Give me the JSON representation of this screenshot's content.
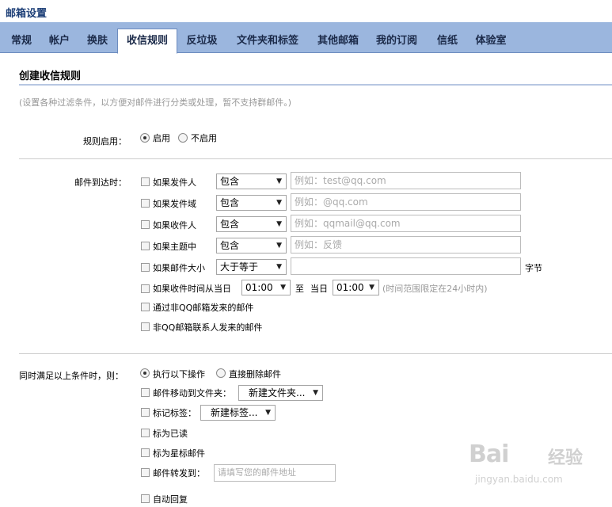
{
  "window": {
    "title": "邮箱设置"
  },
  "tabs": [
    {
      "label": "常规"
    },
    {
      "label": "帐户"
    },
    {
      "label": "换肤"
    },
    {
      "label": "收信规则"
    },
    {
      "label": "反垃圾"
    },
    {
      "label": "文件夹和标签"
    },
    {
      "label": "其他邮箱"
    },
    {
      "label": "我的订阅"
    },
    {
      "label": "信纸"
    },
    {
      "label": "体验室"
    }
  ],
  "section": {
    "title": "创建收信规则",
    "hint": "(设置各种过滤条件，以方便对邮件进行分类或处理，暂不支持群邮件。)"
  },
  "rule_enable": {
    "label": "规则启用：",
    "on": "启用",
    "off": "不启用"
  },
  "conditions": {
    "label": "邮件到达时：",
    "sender": {
      "label": "如果发件人",
      "op": "包含",
      "placeholder": "例如：test@qq.com"
    },
    "domain": {
      "label": "如果发件域",
      "op": "包含",
      "placeholder": "例如：@qq.com"
    },
    "recipient": {
      "label": "如果收件人",
      "op": "包含",
      "placeholder": "例如：qqmail@qq.com"
    },
    "subject": {
      "label": "如果主题中",
      "op": "包含",
      "placeholder": "例如：反馈"
    },
    "size": {
      "label": "如果邮件大小",
      "op": "大于等于",
      "unit": "字节"
    },
    "time": {
      "label": "如果收件时间从当日",
      "from": "01:00",
      "to_label": "至",
      "day_label": "当日",
      "to": "01:00",
      "note": "(时间范围限定在24小时内)"
    },
    "non_qq": "通过非QQ邮箱发来的邮件",
    "non_contact": "非QQ邮箱联系人发来的邮件"
  },
  "actions": {
    "label": "同时满足以上条件时，则：",
    "execute": "执行以下操作",
    "delete": "直接删除邮件",
    "move": {
      "label": "邮件移动到文件夹：",
      "value": "新建文件夹..."
    },
    "tag": {
      "label": "标记标签：",
      "value": "新建标签..."
    },
    "read": "标为已读",
    "star": "标为星标邮件",
    "forward": {
      "label": "邮件转发到：",
      "placeholder": "请填写您的邮件地址"
    },
    "reply": "自动回复"
  },
  "watermark": {
    "brand": "Bai",
    "sub": "jingyan.baidu.com",
    "jy": "经验"
  }
}
